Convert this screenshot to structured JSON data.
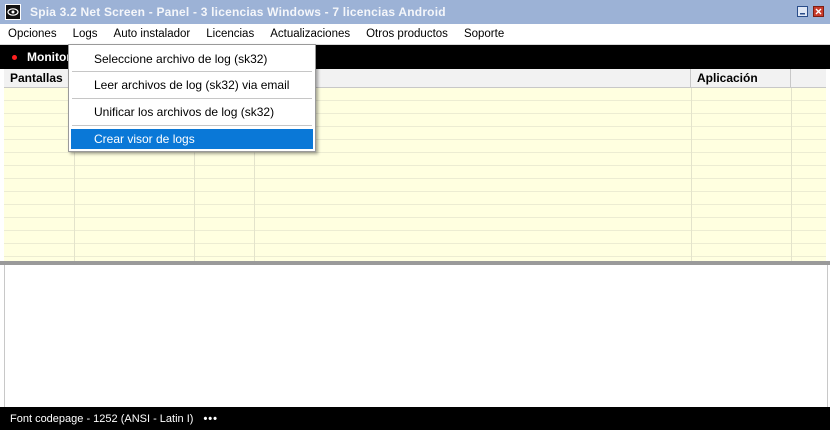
{
  "window": {
    "title": "Spia 3.2 Net Screen   -   Panel   -   3 licencias Windows   -   7 licencias Android",
    "app_icon": "eye-logo-icon",
    "minimize_icon": "minimize-icon",
    "close_icon": "close-icon"
  },
  "menubar": {
    "items": [
      "Opciones",
      "Logs",
      "Auto instalador",
      "Licencias",
      "Actualizaciones",
      "Otros productos",
      "Soporte"
    ]
  },
  "toolbar": {
    "tab_label": "Monitor",
    "status_dot_color": "#ff2020"
  },
  "table": {
    "headers": {
      "pantallas": "Pantallas",
      "aplicacion": "Aplicación"
    },
    "row_color": "#ffffe0"
  },
  "logs_menu": {
    "items": [
      "Seleccione archivo de log (sk32)",
      "Leer archivos de log (sk32) via email",
      "Unificar los archivos de log (sk32)",
      "Crear visor de logs"
    ],
    "selected_index": 3,
    "highlight_color": "#0a78d7"
  },
  "statusbar": {
    "text": "Font codepage - 1252  (ANSI - Latin I)",
    "more": "•••"
  }
}
